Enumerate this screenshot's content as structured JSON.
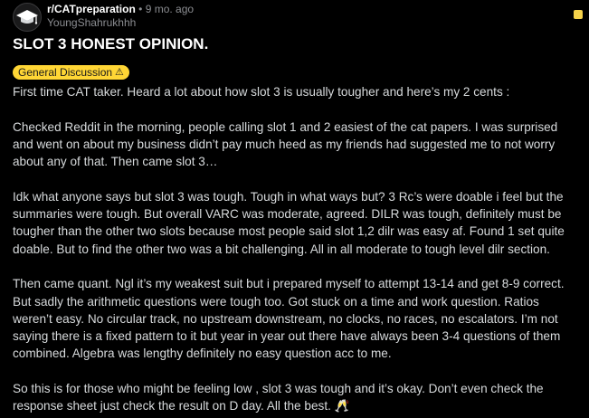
{
  "header": {
    "subreddit": "r/CATpreparation",
    "separator": "•",
    "age": "9 mo. ago",
    "username": "YoungShahrukhhh",
    "avatar_icon": "graduation-cap-icon",
    "menu_icon": "yellow-square-icon"
  },
  "post": {
    "title": "SLOT 3 HONEST OPINION.",
    "flair": {
      "label": "General Discussion",
      "icon": "⚠",
      "color": "#ffd635"
    },
    "paragraphs": [
      "First time CAT taker. Heard a lot about how slot 3 is usually tougher and here’s my 2 cents :",
      "Checked Reddit in the morning, people calling slot 1 and 2 easiest of the cat papers. I was surprised and went on about my business didn’t pay much heed as my friends had suggested me to not worry about any of that. Then came slot 3…",
      "Idk what anyone says but slot 3 was tough. Tough in what ways but? 3 Rc’s were doable i feel but the summaries were tough. But overall VARC was moderate, agreed. DILR was tough, definitely must be tougher than the other two slots because most people said slot 1,2 dilr was easy af. Found 1 set quite doable. But to find the other two was a bit challenging. All in all moderate to tough level dilr section.",
      "Then came quant. Ngl it’s my weakest suit but i prepared myself to attempt 13-14 and get 8-9 correct. But sadly the arithmetic questions were tough too. Got stuck on a time and work question. Ratios weren’t easy. No circular track, no upstream downstream, no clocks, no races, no escalators. I’m not saying there is a fixed pattern to it but year in year out there have always been 3-4 questions of them combined. Algebra was lengthy definitely no easy question acc to me.",
      "So this is for those who might be feeling low , slot 3 was tough and it’s okay. Don’t even check the response sheet just check the result on D day. All the best. 🥂"
    ]
  },
  "colors": {
    "background": "#000000",
    "text": "#d7dadc",
    "muted": "#8b8d91",
    "title": "#ffffff"
  }
}
